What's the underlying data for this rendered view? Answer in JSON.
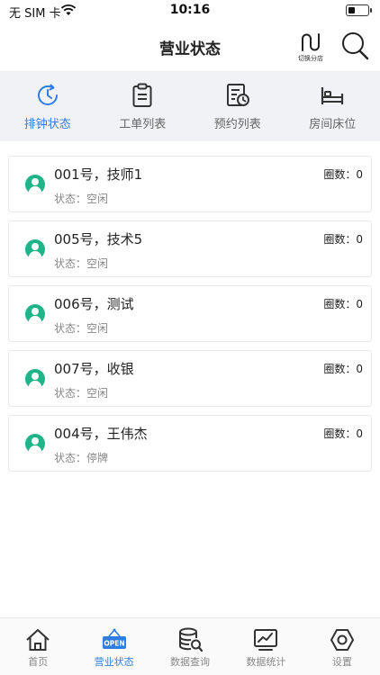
{
  "status_bar": {
    "carrier": "无 SIM 卡",
    "time": "10:16",
    "battery_level": 0.35
  },
  "header": {
    "title": "营业状态",
    "switch_label": "切换分店",
    "icons": {
      "switch": "wave-switch-icon",
      "search": "search-icon"
    }
  },
  "top_tabs": [
    {
      "label": "排钟状态",
      "icon": "clock-refresh-icon",
      "active": true
    },
    {
      "label": "工单列表",
      "icon": "clipboard-icon",
      "active": false
    },
    {
      "label": "预约列表",
      "icon": "schedule-doc-icon",
      "active": false
    },
    {
      "label": "房间床位",
      "icon": "bed-icon",
      "active": false
    }
  ],
  "technicians": [
    {
      "name": "001号，技师1",
      "status": "状态：空闲",
      "rounds": "圈数：0"
    },
    {
      "name": "005号，技术5",
      "status": "状态：空闲",
      "rounds": "圈数：0"
    },
    {
      "name": "006号，测试",
      "status": "状态：空闲",
      "rounds": "圈数：0"
    },
    {
      "name": "007号，收银",
      "status": "状态：空闲",
      "rounds": "圈数：0"
    },
    {
      "name": "004号，王伟杰",
      "status": "状态：停牌",
      "rounds": "圈数：0"
    }
  ],
  "bottom_nav": [
    {
      "label": "首页",
      "icon": "home-icon",
      "active": false
    },
    {
      "label": "营业状态",
      "icon": "open-sign-icon",
      "badge": "OPEN",
      "active": true
    },
    {
      "label": "数据查询",
      "icon": "database-search-icon",
      "active": false
    },
    {
      "label": "数据统计",
      "icon": "line-chart-icon",
      "active": false
    },
    {
      "label": "设置",
      "icon": "settings-icon",
      "active": false
    }
  ],
  "colors": {
    "accent": "#2f7de1",
    "avatar": "#21b488",
    "tab_bar_bg": "#f1f2f5"
  }
}
